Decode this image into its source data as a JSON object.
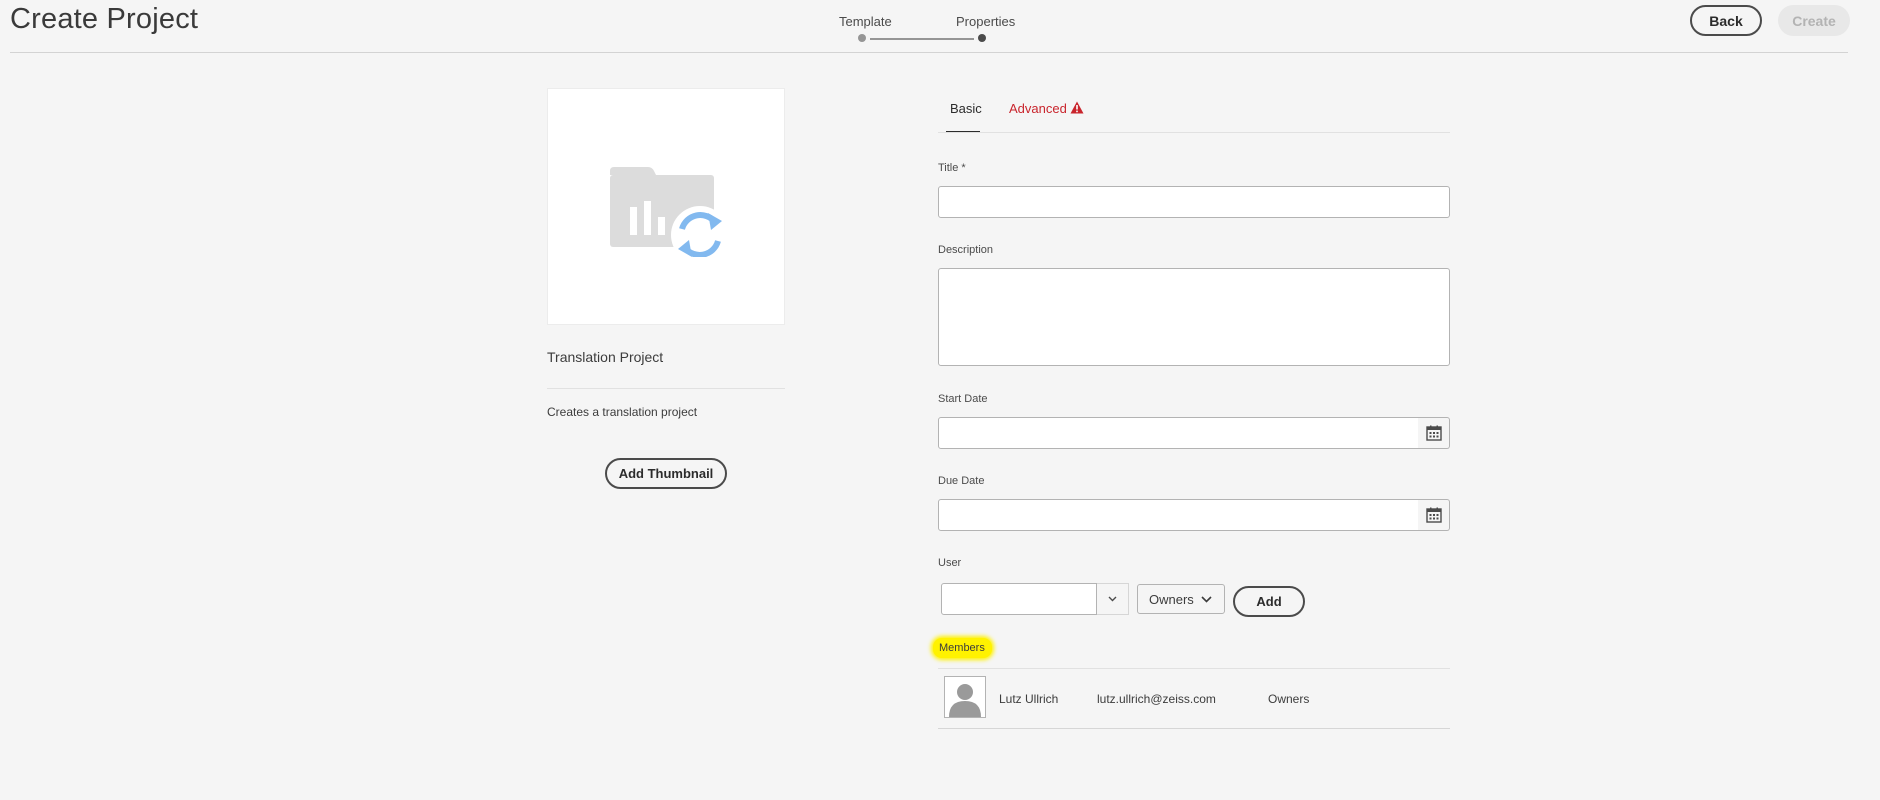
{
  "header": {
    "title": "Create Project",
    "steps": [
      {
        "label": "Template",
        "state": "completed"
      },
      {
        "label": "Properties",
        "state": "current"
      }
    ],
    "back_label": "Back",
    "create_label": "Create"
  },
  "template_card": {
    "icon": "translation-project-icon",
    "name": "Translation Project",
    "description": "Creates a translation project",
    "add_thumbnail_label": "Add Thumbnail"
  },
  "tabs": [
    {
      "label": "Basic",
      "active": true
    },
    {
      "label": "Advanced",
      "active": false,
      "warning": true
    }
  ],
  "form": {
    "title_label": "Title *",
    "title_value": "",
    "description_label": "Description",
    "description_value": "",
    "start_date_label": "Start Date",
    "start_date_value": "",
    "due_date_label": "Due Date",
    "due_date_value": "",
    "user_label": "User",
    "user_value": "",
    "role_selected": "Owners",
    "add_label": "Add"
  },
  "members": {
    "label": "Members",
    "highlight_color": "#fff200",
    "rows": [
      {
        "name": "Lutz Ullrich",
        "email": "lutz.ullrich@zeiss.com",
        "role": "Owners"
      }
    ]
  },
  "colors": {
    "warning": "#c9252d",
    "icon_blue": "#82b9ef",
    "icon_gray": "#dcdcdc"
  }
}
